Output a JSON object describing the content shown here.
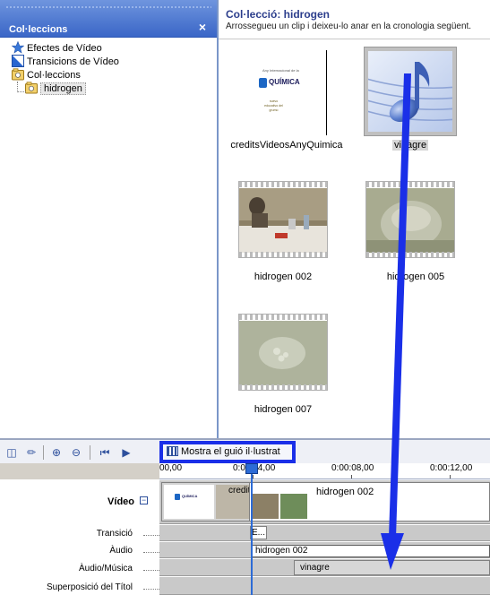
{
  "collections_pane": {
    "title": "Col·leccions",
    "close_glyph": "×",
    "items": [
      {
        "label": "Efectes de Vídeo",
        "icon": "star-effects-icon"
      },
      {
        "label": "Transicions de Vídeo",
        "icon": "transition-icon"
      },
      {
        "label": "Col·leccions",
        "icon": "collections-folder-icon"
      },
      {
        "label": "hidrogen",
        "icon": "collection-folder-icon"
      }
    ]
  },
  "contents_pane": {
    "title": "Col·lecció: hidrogen",
    "subtitle": "Arrossegueu un clip i deixeu-lo anar en la cronologia següent.",
    "clips": [
      {
        "caption": "creditsVideosAnyQuimica",
        "logo_text_main": "QUÍMICA",
        "logo_text_top": "Any Internacional de la",
        "logo_text_small": "nuevo educativo del grumo"
      },
      {
        "caption": "vinagre",
        "selected": true
      },
      {
        "caption": "hidrogen 002"
      },
      {
        "caption": "hidrogen 005"
      },
      {
        "caption": "hidrogen 007"
      }
    ]
  },
  "toolbar": {
    "storyboard_label": "Mostra el guió il·lustrat"
  },
  "timeline": {
    "ruler": [
      "00,00",
      "0:00:04,00",
      "0:00:08,00",
      "0:00:12,00"
    ],
    "tracks": {
      "video": "Vídeo",
      "transition": "Transició",
      "audio": "Àudio",
      "audio_music": "Àudio/Música",
      "title_overlay": "Superposició del Títol"
    },
    "video_clips": [
      "creditsVi...",
      "hidrogen 002"
    ],
    "transition_clip": "E...",
    "audio_clip": "hidrogen 002",
    "music_clip": "vinagre"
  },
  "colors": {
    "annotation_blue": "#1a2fe8",
    "playhead": "#2c6bd6",
    "header_blue": "#3a66c7"
  }
}
